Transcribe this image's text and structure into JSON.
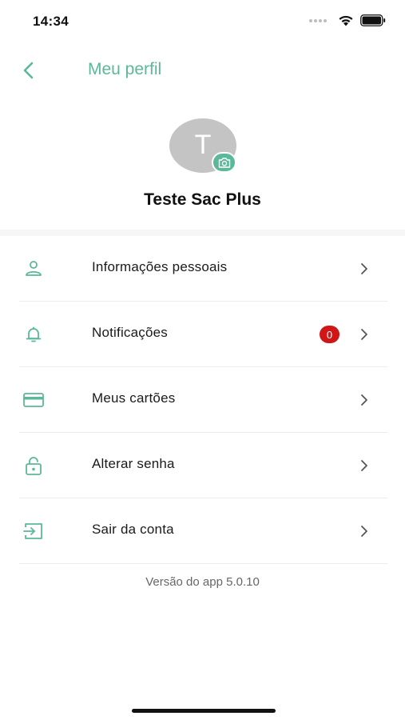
{
  "status_bar": {
    "time": "14:34",
    "icons": [
      "signal-icon",
      "wifi-icon",
      "battery-icon"
    ]
  },
  "nav": {
    "back_icon": "chevron-left-icon",
    "title": "Meu perfil"
  },
  "profile": {
    "avatar_initial": "T",
    "camera_icon": "camera-icon",
    "name": "Teste Sac Plus"
  },
  "menu": {
    "items": [
      {
        "label": "Informações pessoais",
        "icon": "user-icon"
      },
      {
        "label": "Notificações",
        "icon": "bell-icon",
        "badge": "0"
      },
      {
        "label": "Meus cartões",
        "icon": "credit-card-icon"
      },
      {
        "label": "Alterar senha",
        "icon": "lock-icon"
      },
      {
        "label": "Sair da conta",
        "icon": "logout-icon"
      }
    ]
  },
  "footer": {
    "version": "Versão do app 5.0.10"
  },
  "colors": {
    "accent": "#5bb89a",
    "badge": "#d01616",
    "avatar": "#c4c4c4"
  }
}
